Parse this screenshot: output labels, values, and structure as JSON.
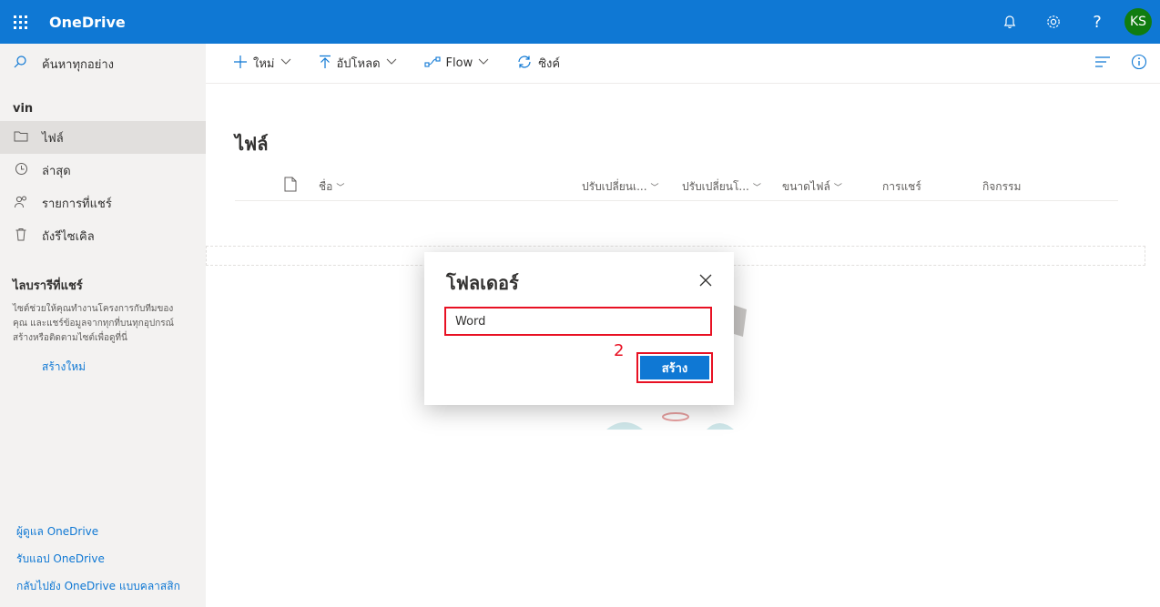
{
  "topbar": {
    "app_title": "OneDrive",
    "icons": [
      "waffle-icon",
      "bell-icon",
      "gear-icon",
      "help-icon"
    ],
    "help_label": "?",
    "avatar_initials": "KS",
    "colors": {
      "bar": "#0f78d4",
      "avatar": "#107c10"
    }
  },
  "leftnav": {
    "search_placeholder": "ค้นหาทุกอย่าง",
    "group_title": "vin",
    "items": [
      {
        "label": "ไฟล์",
        "icon": "folder-icon",
        "active": true
      },
      {
        "label": "ล่าสุด",
        "icon": "clock-icon"
      },
      {
        "label": "รายการที่แชร์",
        "icon": "people-icon"
      },
      {
        "label": "ถังรีไซเคิล",
        "icon": "recycle-bin-icon"
      }
    ],
    "shared_section": {
      "title": "ไลบรารีที่แชร์",
      "description": "ไซต์ช่วยให้คุณทำงานโครงการกับทีมของ\nคุณ และแชร์ข้อมูลจากทุกที่บนทุกอุปกรณ์\nสร้างหรือติดตามไซต์เพื่อดูที่นี่",
      "create_link": "สร้างใหม่"
    },
    "bottom_links": [
      "ผู้ดูแล OneDrive",
      "รับแอป OneDrive",
      "กลับไปยัง OneDrive แบบคลาสสิก"
    ]
  },
  "commandbar": {
    "new_label": "ใหม่",
    "upload_label": "อัปโหลด",
    "flow_label": "Flow",
    "sync_label": "ซิงค์"
  },
  "main": {
    "title": "ไฟล์",
    "columns": {
      "name": "ชื่อ",
      "modified": "ปรับเปลี่ยนเ...",
      "modified_by": "ปรับเปลี่ยนโ...",
      "size": "ขนาดไฟล์",
      "sharing": "การแชร์",
      "activity": "กิจกรรม"
    }
  },
  "dialog": {
    "title": "โฟลเดอร์",
    "input_value": "Word",
    "step_number": "2",
    "create_label": "สร้าง",
    "highlight_color": "#e81123"
  }
}
